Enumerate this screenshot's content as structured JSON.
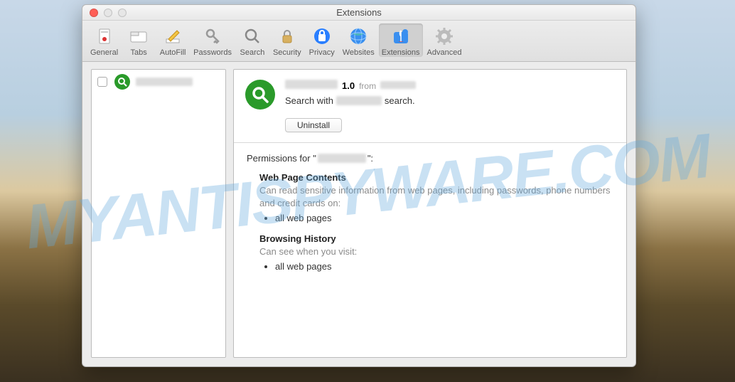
{
  "window": {
    "title": "Extensions"
  },
  "toolbar": {
    "items": [
      {
        "label": "General"
      },
      {
        "label": "Tabs"
      },
      {
        "label": "AutoFill"
      },
      {
        "label": "Passwords"
      },
      {
        "label": "Search"
      },
      {
        "label": "Security"
      },
      {
        "label": "Privacy"
      },
      {
        "label": "Websites"
      },
      {
        "label": "Extensions"
      },
      {
        "label": "Advanced"
      }
    ]
  },
  "detail": {
    "version": "1.0",
    "from": "from",
    "desc_pre": "Search with",
    "desc_post": "search.",
    "uninstall": "Uninstall",
    "perm_prefix": "Permissions for \"",
    "perm_suffix": "\":",
    "perm_webcontent_h": "Web Page Contents",
    "perm_webcontent_d": "Can read sensitive information from web pages, including passwords, phone numbers and credit cards on:",
    "perm_webcontent_li": "all web pages",
    "perm_history_h": "Browsing History",
    "perm_history_d": "Can see when you visit:",
    "perm_history_li": "all web pages"
  },
  "watermark": "MYANTISPYWARE.COM"
}
